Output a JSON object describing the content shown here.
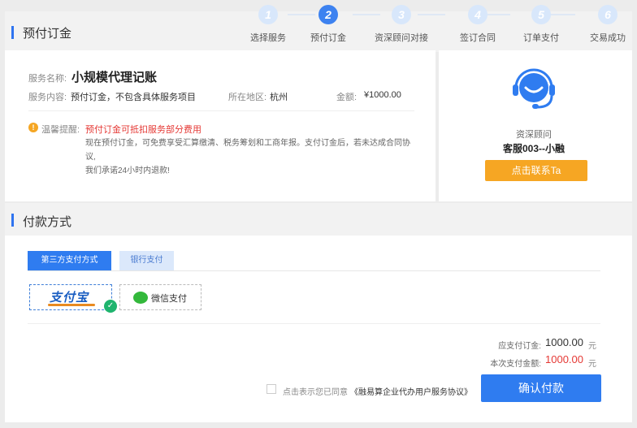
{
  "order_section": {
    "title": "预付订金"
  },
  "steps": [
    {
      "num": "1",
      "label": "选择服务",
      "active": false
    },
    {
      "num": "2",
      "label": "预付订金",
      "active": true
    },
    {
      "num": "3",
      "label": "资深顾问对接",
      "active": false
    },
    {
      "num": "4",
      "label": "签订合同",
      "active": false
    },
    {
      "num": "5",
      "label": "订单支付",
      "active": false
    },
    {
      "num": "6",
      "label": "交易成功",
      "active": false
    }
  ],
  "service": {
    "name_label": "服务名称:",
    "name_value": "小规模代理记账",
    "content_label": "服务内容:",
    "content_value": "预付订金，不包含具体服务项目",
    "region_label": "所在地区:",
    "region_value": "杭州",
    "amount_label": "金额:",
    "amount_value": "¥1000.00"
  },
  "warning": {
    "icon": "exclamation-icon",
    "label": "温馨提醒:",
    "headline": "预付订金可抵扣服务部分费用",
    "line1": "现在预付订金，可免费享受汇算缴清、税务筹划和工商年报。支付订金后，若未达成合同协议,",
    "line2": "我们承诺24小时内退款!"
  },
  "consultant": {
    "icon": "customer-service-headset-icon",
    "role": "资深顾问",
    "name": "客服003--小融",
    "contact_button": "点击联系Ta"
  },
  "payment_section": {
    "title": "付款方式",
    "tabs": [
      {
        "label": "第三方支付方式",
        "active": true
      },
      {
        "label": "银行支付",
        "active": false
      }
    ],
    "alipay_logo": "支付宝",
    "wechat_label": "微信支付",
    "selected": "alipay"
  },
  "summary": {
    "deposit_label": "应支付订金:",
    "deposit_value": "1000.00",
    "deposit_unit": "元",
    "current_label": "本次支付金额:",
    "current_value": "1000.00",
    "current_unit": "元"
  },
  "agreement": {
    "prefix": "点击表示您已同意",
    "link": "《融易算企业代办用户服务协议》"
  },
  "confirm_button": "确认付款",
  "colors": {
    "primary": "#2f7cf0",
    "accent_orange": "#f6a623",
    "danger": "#e53935",
    "success": "#1fb46e"
  }
}
